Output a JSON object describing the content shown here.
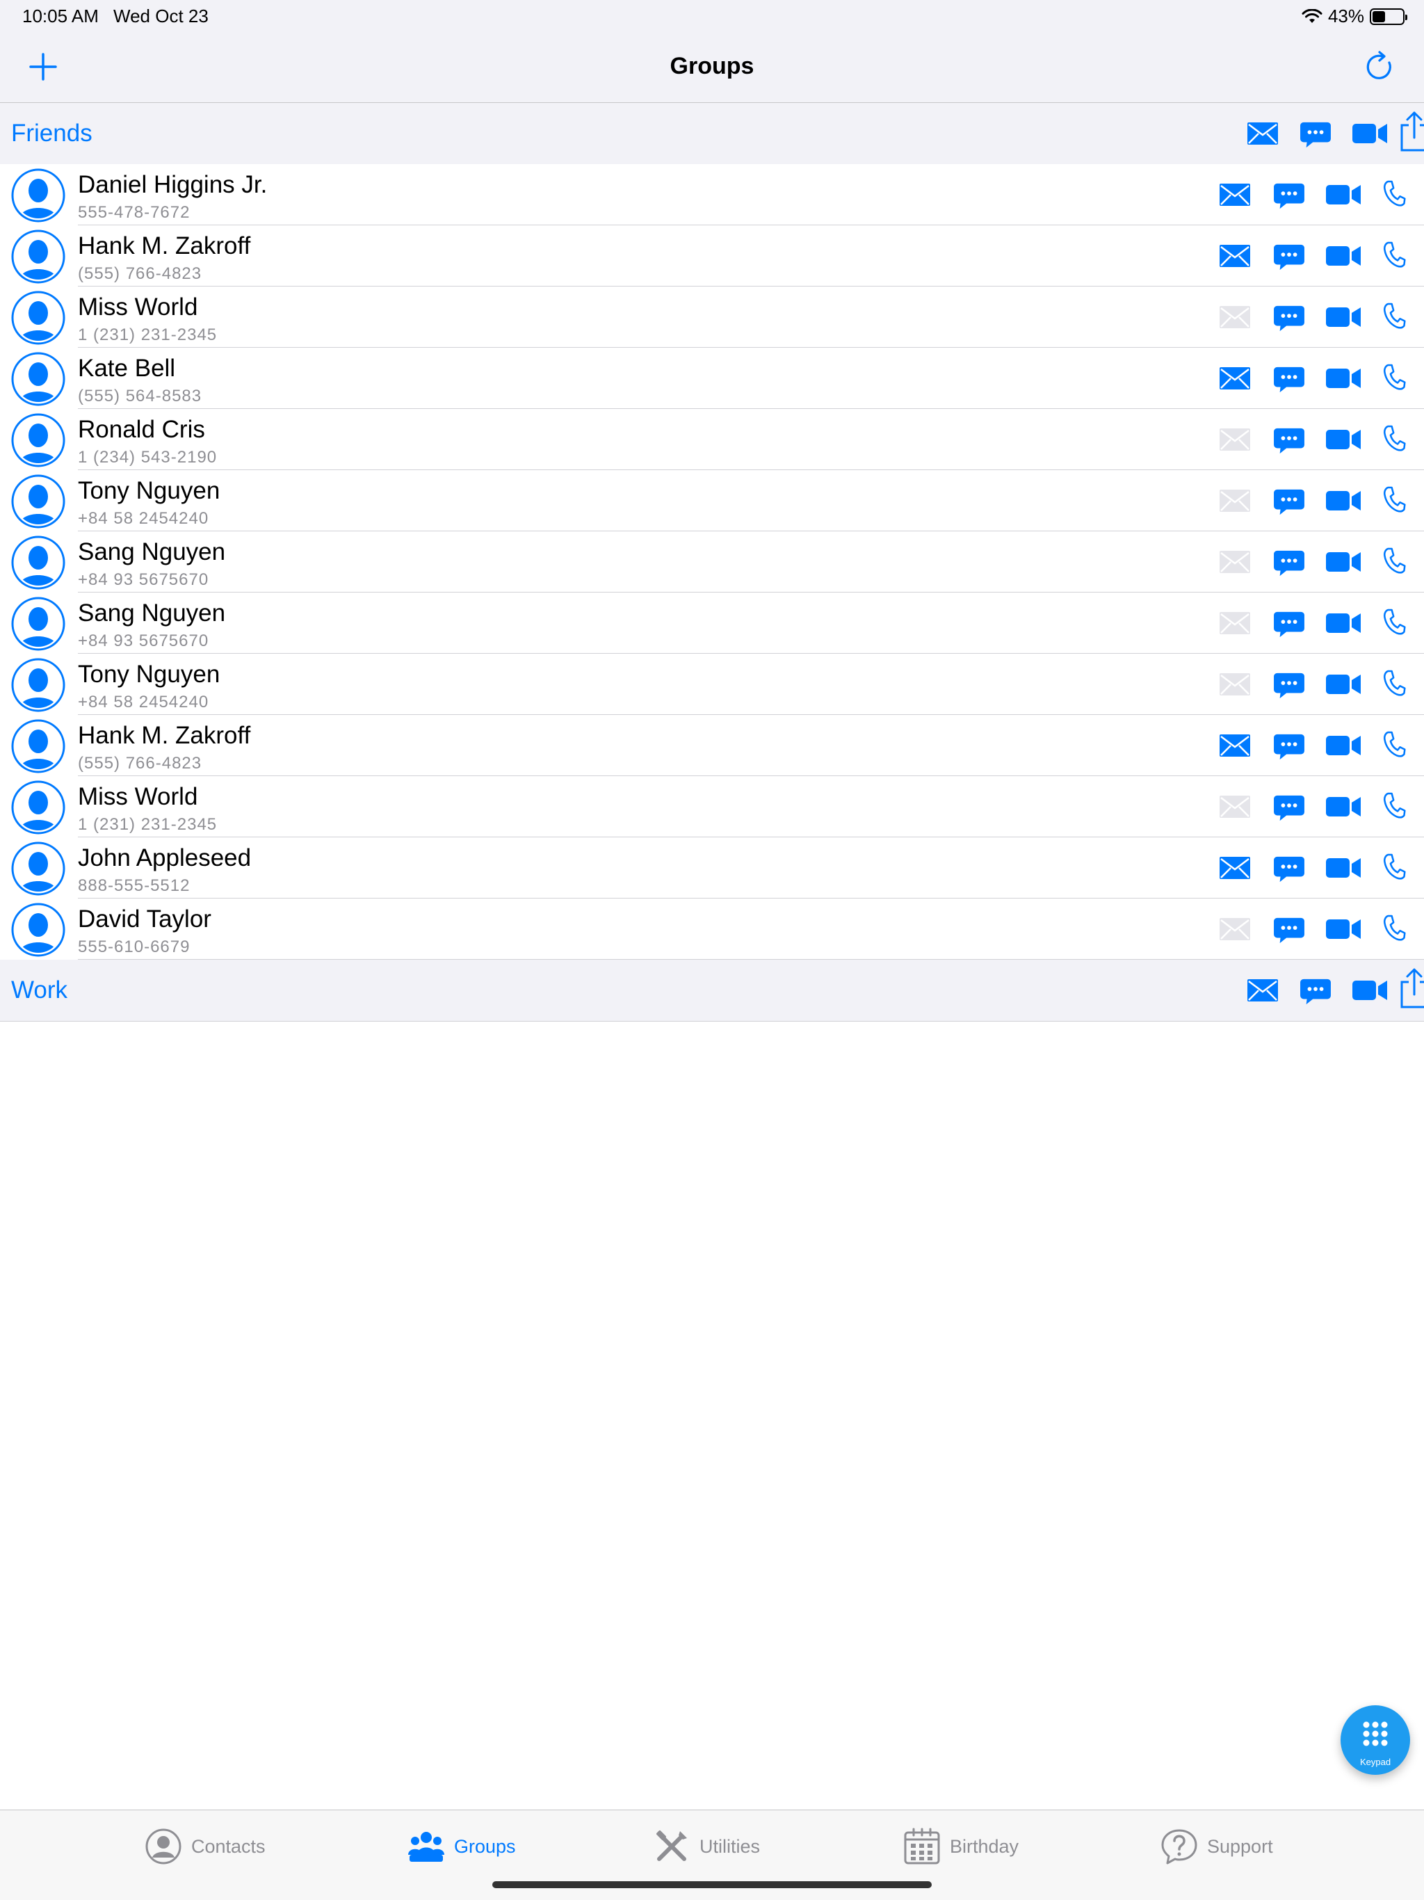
{
  "status_bar": {
    "time": "10:05 AM",
    "date": "Wed Oct 23",
    "battery": "43%",
    "battery_fraction": 0.43
  },
  "nav": {
    "title": "Groups"
  },
  "groups": [
    {
      "name": "Friends",
      "contacts": [
        {
          "name": "Daniel Higgins Jr.",
          "phone": "555-478-7672",
          "has_email": true
        },
        {
          "name": "Hank M. Zakroff",
          "phone": "(555) 766-4823",
          "has_email": true
        },
        {
          "name": "Miss World",
          "phone": "1 (231) 231-2345",
          "has_email": false
        },
        {
          "name": "Kate Bell",
          "phone": "(555) 564-8583",
          "has_email": true
        },
        {
          "name": "Ronald Cris",
          "phone": "1 (234) 543-2190",
          "has_email": false
        },
        {
          "name": "Tony Nguyen",
          "phone": "+84 58 2454240",
          "has_email": false
        },
        {
          "name": "Sang Nguyen",
          "phone": "+84 93 5675670",
          "has_email": false
        },
        {
          "name": "Sang Nguyen",
          "phone": "+84 93 5675670",
          "has_email": false
        },
        {
          "name": "Tony Nguyen",
          "phone": "+84 58 2454240",
          "has_email": false
        },
        {
          "name": "Hank M. Zakroff",
          "phone": "(555) 766-4823",
          "has_email": true
        },
        {
          "name": "Miss World",
          "phone": "1 (231) 231-2345",
          "has_email": false
        },
        {
          "name": "John Appleseed",
          "phone": "888-555-5512",
          "has_email": true
        },
        {
          "name": "David Taylor",
          "phone": "555-610-6679",
          "has_email": false
        }
      ]
    },
    {
      "name": "Work",
      "contacts": []
    }
  ],
  "fab": {
    "label": "Keypad"
  },
  "tabs": [
    {
      "label": "Contacts",
      "icon": "person-circle-icon",
      "active": false
    },
    {
      "label": "Groups",
      "icon": "people-group-icon",
      "active": true
    },
    {
      "label": "Utilities",
      "icon": "tools-icon",
      "active": false
    },
    {
      "label": "Birthday",
      "icon": "calendar-icon",
      "active": false
    },
    {
      "label": "Support",
      "icon": "question-bubble-icon",
      "active": false
    }
  ],
  "colors": {
    "accent": "#007aff",
    "disabled": "#e5e5ea",
    "fab": "#1e9cf0"
  }
}
